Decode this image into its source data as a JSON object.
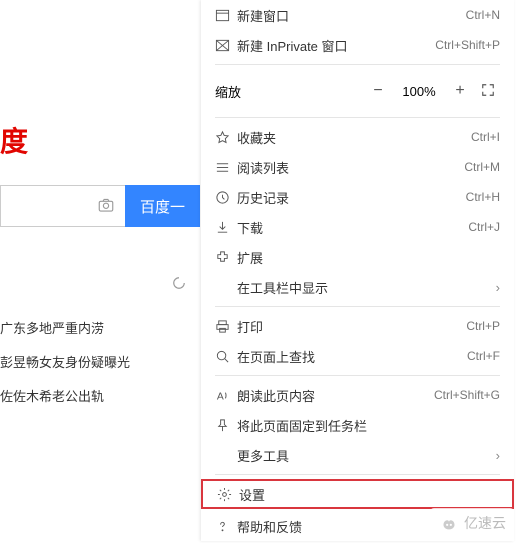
{
  "background": {
    "logo_fragment": "度",
    "search_button": "百度一",
    "hot_items": [
      "广东多地严重内涝",
      "彭昱畅女友身份疑曝光",
      "佐佐木希老公出轨"
    ]
  },
  "menu": {
    "new_window": {
      "label": "新建窗口",
      "shortcut": "Ctrl+N"
    },
    "new_inprivate": {
      "label": "新建 InPrivate 窗口",
      "shortcut": "Ctrl+Shift+P"
    },
    "zoom": {
      "label": "缩放",
      "value": "100%"
    },
    "favorites": {
      "label": "收藏夹",
      "shortcut": "Ctrl+I"
    },
    "reading_list": {
      "label": "阅读列表",
      "shortcut": "Ctrl+M"
    },
    "history": {
      "label": "历史记录",
      "shortcut": "Ctrl+H"
    },
    "downloads": {
      "label": "下载",
      "shortcut": "Ctrl+J"
    },
    "extensions": {
      "label": "扩展"
    },
    "show_in_toolbar": {
      "label": "在工具栏中显示"
    },
    "print": {
      "label": "打印",
      "shortcut": "Ctrl+P"
    },
    "find": {
      "label": "在页面上查找",
      "shortcut": "Ctrl+F"
    },
    "read_aloud": {
      "label": "朗读此页内容",
      "shortcut": "Ctrl+Shift+G"
    },
    "pin_to_taskbar": {
      "label": "将此页面固定到任务栏"
    },
    "more_tools": {
      "label": "更多工具"
    },
    "settings": {
      "label": "设置"
    },
    "help": {
      "label": "帮助和反馈"
    }
  },
  "watermark": "亿速云"
}
